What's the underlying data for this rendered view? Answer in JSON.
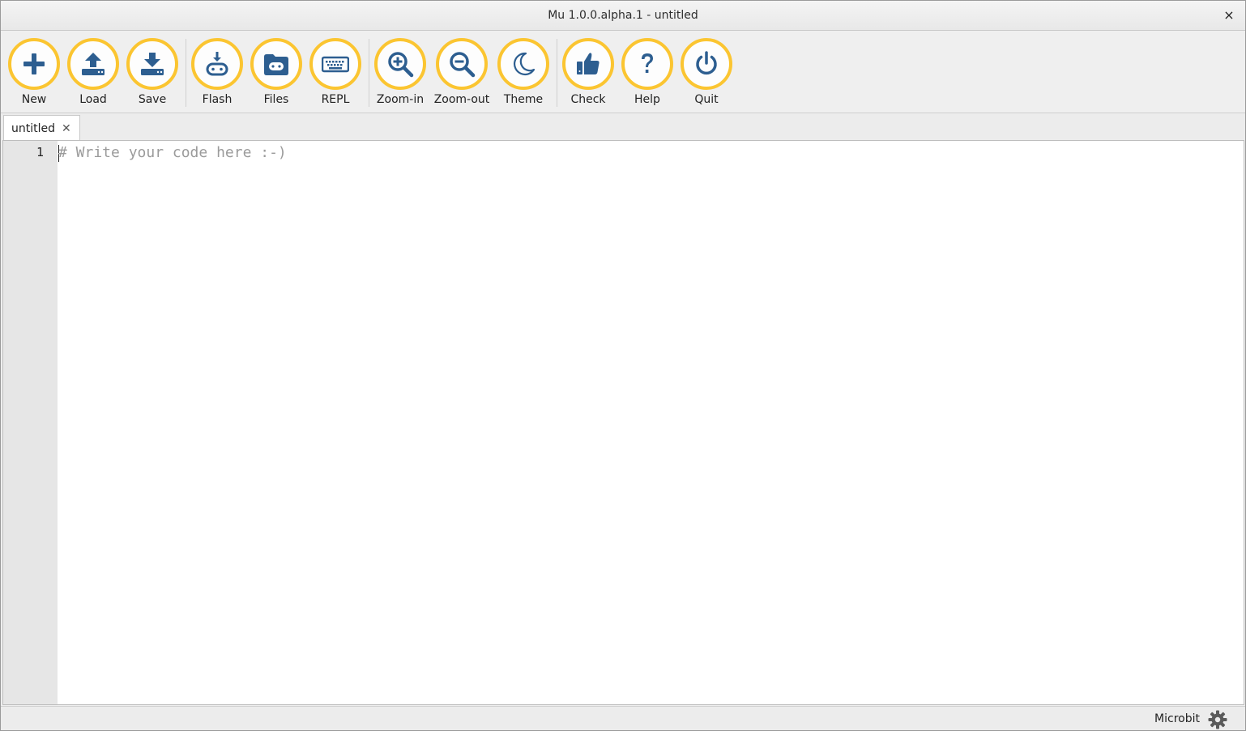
{
  "window": {
    "title": "Mu 1.0.0.alpha.1 - untitled",
    "close_glyph": "×"
  },
  "toolbar": {
    "buttons": [
      {
        "label": "New",
        "icon": "plus-icon"
      },
      {
        "label": "Load",
        "icon": "upload-icon"
      },
      {
        "label": "Save",
        "icon": "download-icon"
      },
      {
        "label": "Flash",
        "icon": "flash-microbit-icon"
      },
      {
        "label": "Files",
        "icon": "folder-icon"
      },
      {
        "label": "REPL",
        "icon": "keyboard-icon"
      },
      {
        "label": "Zoom-in",
        "icon": "zoom-in-icon"
      },
      {
        "label": "Zoom-out",
        "icon": "zoom-out-icon"
      },
      {
        "label": "Theme",
        "icon": "moon-icon"
      },
      {
        "label": "Check",
        "icon": "thumbs-up-icon"
      },
      {
        "label": "Help",
        "icon": "question-icon"
      },
      {
        "label": "Quit",
        "icon": "power-icon"
      }
    ],
    "colors": {
      "ring": "#fbc531",
      "icon": "#2d5e90"
    }
  },
  "tabs": [
    {
      "name": "untitled",
      "close_glyph": "✕"
    }
  ],
  "editor": {
    "line_numbers": [
      "1"
    ],
    "lines": [
      "# Write your code here :-)"
    ]
  },
  "status": {
    "mode": "Microbit",
    "settings_icon": "gear-icon"
  }
}
